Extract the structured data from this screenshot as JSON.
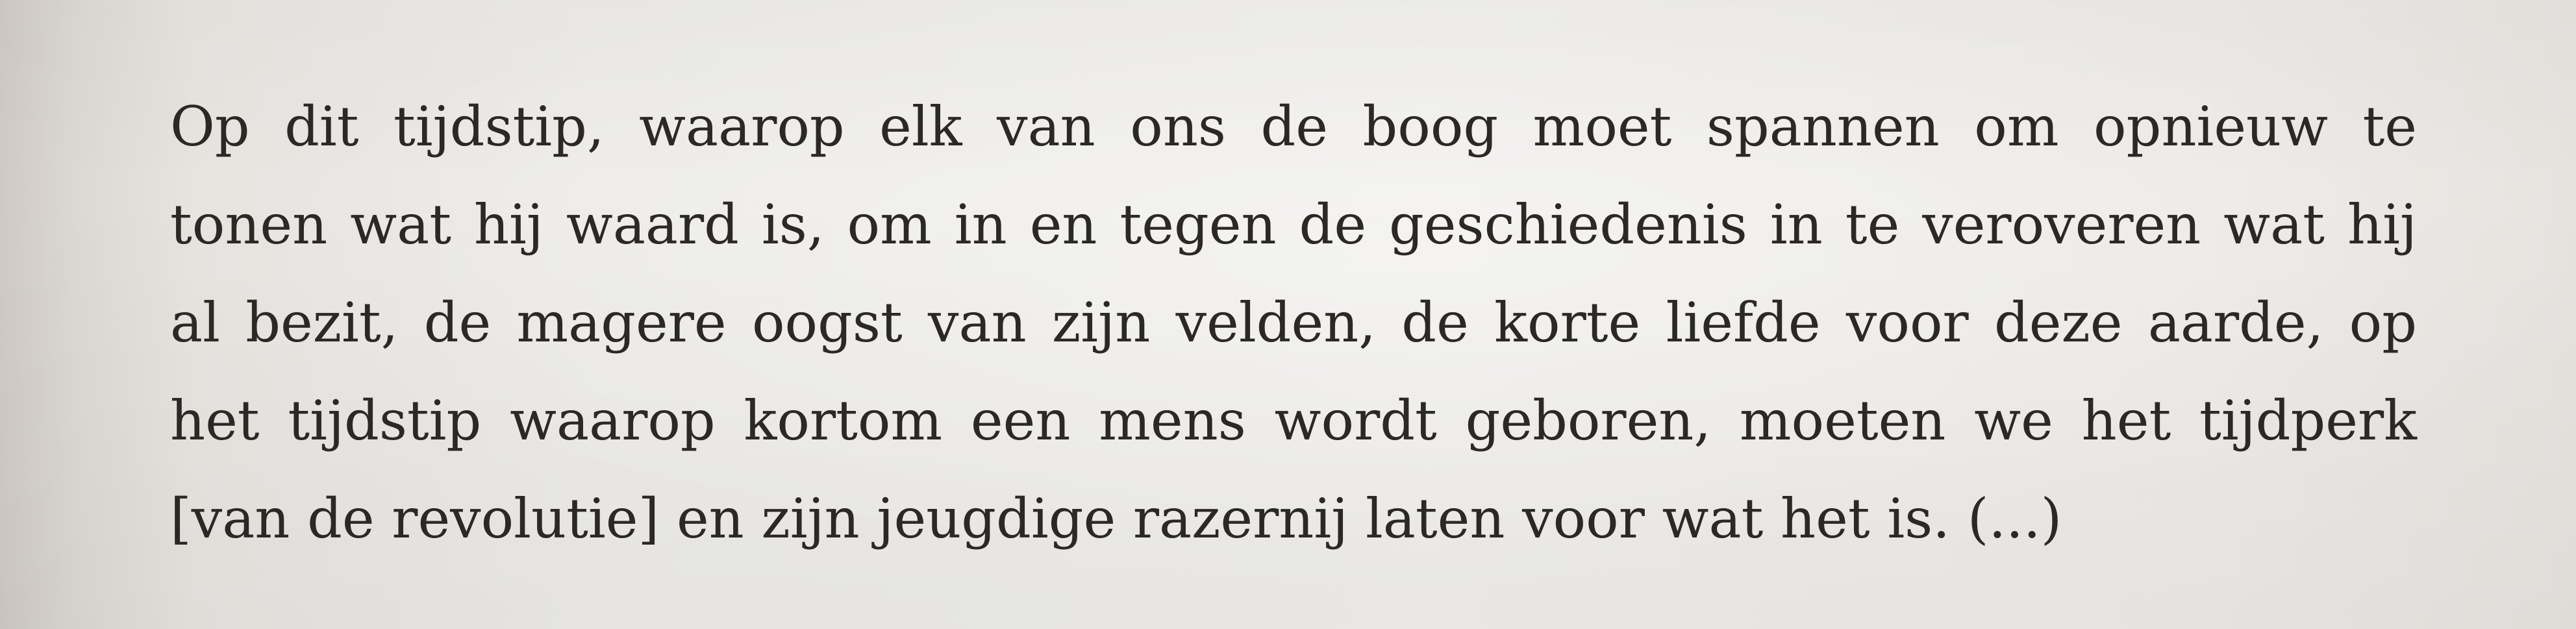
{
  "page": {
    "lines": [
      "Op dit tijdstip, waarop elk van ons de boog moet spannen om opnieuw te",
      "tonen wat hij waard is, om in en tegen de geschiedenis in te veroveren wat hij",
      "al bezit, de magere oogst van zijn velden, de korte liefde voor deze aarde, op",
      "het tijdstip waarop kortom een mens wordt geboren, moeten we het tijdperk",
      "[van de revolutie] en zijn jeugdige razernij laten voor wat het is. (...)"
    ]
  },
  "colors": {
    "paper": "#ecebe8",
    "ink": "#2b2826"
  }
}
